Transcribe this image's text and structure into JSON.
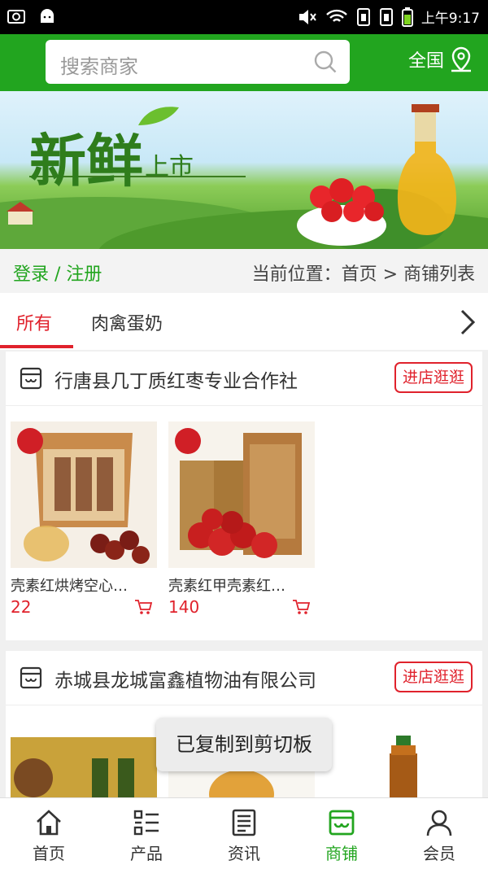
{
  "status_bar": {
    "time": "上午9:17"
  },
  "header": {
    "search_placeholder": "搜索商家",
    "region": "全国"
  },
  "banner": {
    "headline_main": "新鲜",
    "headline_sub": "上市"
  },
  "breadcrumb": {
    "login": "登录 / 注册",
    "location": "当前位置：首页 > 商铺列表"
  },
  "tabs": [
    {
      "label": "所有",
      "active": true
    },
    {
      "label": "肉禽蛋奶",
      "active": false
    }
  ],
  "shops": [
    {
      "name": "行唐县几丁质红枣专业合作社",
      "visit_label": "进店逛逛",
      "products": [
        {
          "name": "壳素红烘烤空心…",
          "price": "22"
        },
        {
          "name": "壳素红甲壳素红…",
          "price": "140"
        }
      ]
    },
    {
      "name": "赤城县龙城富鑫植物油有限公司",
      "visit_label": "进店逛逛",
      "products": []
    }
  ],
  "toast": "已复制到剪切板",
  "bottom_nav": [
    {
      "label": "首页",
      "icon": "home-icon",
      "active": false
    },
    {
      "label": "产品",
      "icon": "list-icon",
      "active": false
    },
    {
      "label": "资讯",
      "icon": "news-icon",
      "active": false
    },
    {
      "label": "商铺",
      "icon": "store-icon",
      "active": true
    },
    {
      "label": "会员",
      "icon": "user-icon",
      "active": false
    }
  ],
  "colors": {
    "brand_green": "#22a51f",
    "accent_red": "#e0222c"
  }
}
